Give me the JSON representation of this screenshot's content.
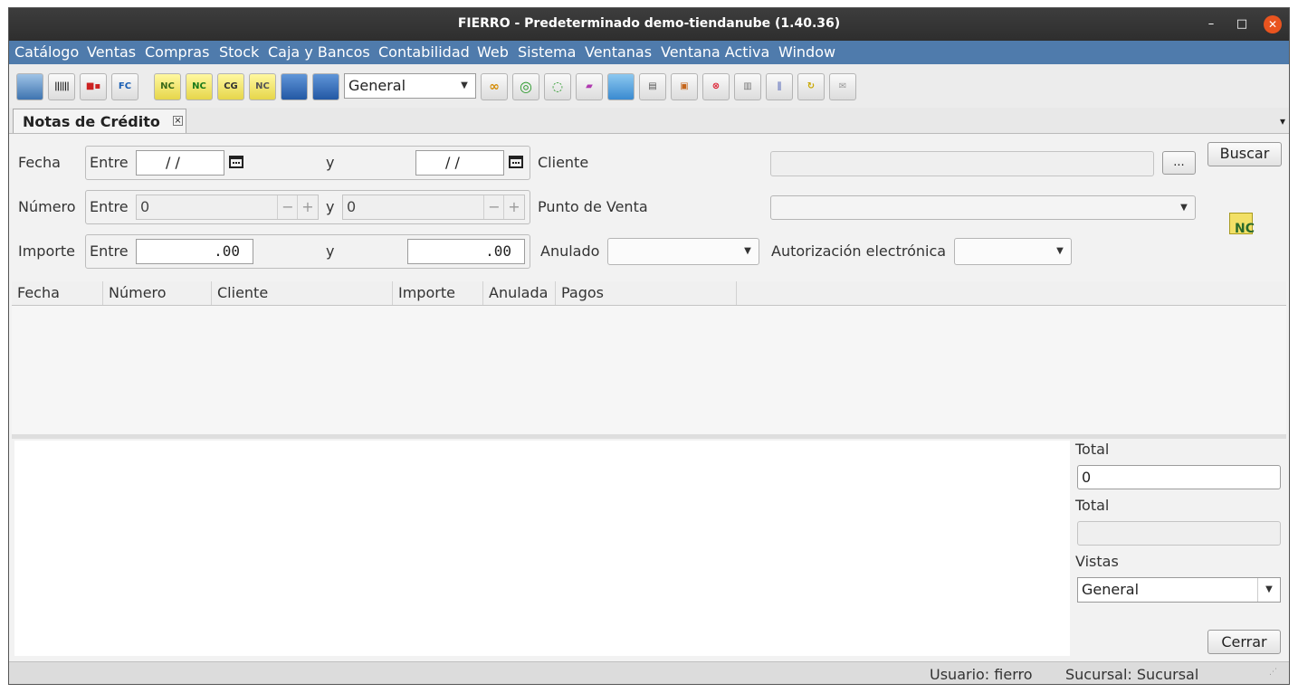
{
  "window": {
    "title": "FIERRO - Predeterminado demo-tiendanube (1.40.36)",
    "minimize": "–",
    "maximize": "□",
    "close": "✕"
  },
  "menu": [
    "Catálogo",
    "Ventas",
    "Compras",
    "Stock",
    "Caja y Bancos",
    "Contabilidad",
    "Web",
    "Sistema",
    "Ventanas",
    "Ventana Activa",
    "Window"
  ],
  "toolbar": {
    "buttons_left": [
      {
        "icon": "book-icon"
      },
      {
        "icon": "barcode-icon"
      },
      {
        "icon": "truck-icon"
      },
      {
        "icon": "invoice-fc-icon",
        "text": "FC"
      }
    ],
    "buttons_doc": [
      {
        "icon": "credit-note-icon",
        "text": "NC"
      },
      {
        "icon": "credit-note-green-icon",
        "text": "NC"
      },
      {
        "icon": "cg-icon",
        "text": "CG"
      },
      {
        "icon": "credit-note-2-icon",
        "text": "NC"
      },
      {
        "icon": "list-view-icon"
      },
      {
        "icon": "list-view-2-icon"
      }
    ],
    "view_select": "General",
    "buttons_right": [
      {
        "icon": "link-icon"
      },
      {
        "icon": "target-icon"
      },
      {
        "icon": "toggle-icon"
      },
      {
        "icon": "eraser-icon"
      },
      {
        "icon": "image-icon"
      },
      {
        "icon": "printer-icon"
      },
      {
        "icon": "save-icon"
      },
      {
        "icon": "delete-icon"
      },
      {
        "icon": "print-icon"
      },
      {
        "icon": "attach-icon"
      },
      {
        "icon": "refresh-icon"
      },
      {
        "icon": "mail-icon"
      }
    ]
  },
  "tab": {
    "label": "Notas de Crédito",
    "close": "⊠",
    "menu_arrow": "▾"
  },
  "filters": {
    "fecha_label": "Fecha",
    "numero_label": "Número",
    "importe_label": "Importe",
    "entre": "Entre",
    "y": "y",
    "fecha_from": "/ /",
    "fecha_to": "/ /",
    "numero_from": "0",
    "numero_to": "0",
    "importe_from": ".00",
    "importe_to": ".00",
    "cliente_label": "Cliente",
    "cliente_value": "",
    "cliente_browse": "...",
    "punto_venta_label": "Punto de Venta",
    "punto_venta_value": "",
    "anulado_label": "Anulado",
    "anulado_value": "",
    "autorizacion_label": "Autorización electrónica",
    "autorizacion_value": "",
    "buscar": "Buscar",
    "nc_badge": "NC"
  },
  "table": {
    "columns": [
      "Fecha",
      "Número",
      "Cliente",
      "Importe",
      "Anulada",
      "Pagos"
    ],
    "rows": []
  },
  "summary": {
    "total1_label": "Total",
    "total1_value": "0",
    "total2_label": "Total",
    "total2_value": "",
    "vistas_label": "Vistas",
    "vistas_value": "General",
    "cerrar": "Cerrar"
  },
  "status": {
    "usuario": "Usuario: fierro",
    "sucursal": "Sucursal: Sucursal"
  }
}
